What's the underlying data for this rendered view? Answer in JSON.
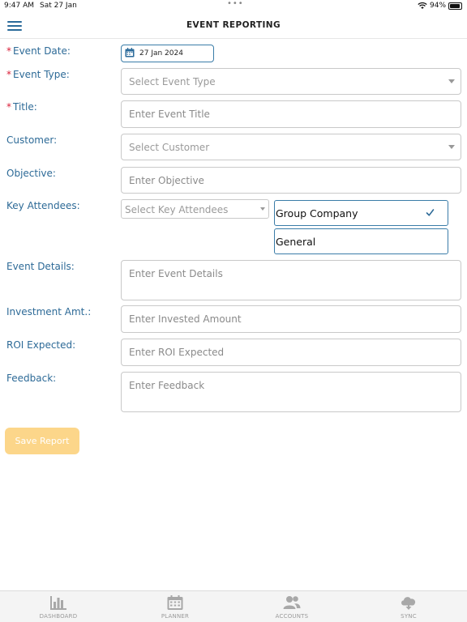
{
  "status_bar": {
    "time": "9:47 AM",
    "date": "Sat 27 Jan",
    "battery": "94%"
  },
  "header": {
    "title": "EVENT REPORTING"
  },
  "form": {
    "event_date": {
      "label": "Event Date:",
      "required": "*",
      "value": "27 Jan 2024"
    },
    "event_type": {
      "label": "Event Type:",
      "required": "*",
      "placeholder": "Select Event Type"
    },
    "title": {
      "label": "Title:",
      "required": "*",
      "placeholder": "Enter Event Title"
    },
    "customer": {
      "label": "Customer:",
      "placeholder": "Select Customer"
    },
    "objective": {
      "label": "Objective:",
      "placeholder": "Enter Objective"
    },
    "key_attendees": {
      "label": "Key Attendees:",
      "placeholder": "Select Key Attendees",
      "options": [
        {
          "label": "Group Company",
          "selected": true
        },
        {
          "label": "General",
          "selected": false
        }
      ]
    },
    "event_details": {
      "label": "Event Details:",
      "placeholder": "Enter Event Details"
    },
    "investment": {
      "label": "Investment Amt.:",
      "placeholder": "Enter Invested Amount"
    },
    "roi": {
      "label": "ROI Expected:",
      "placeholder": "Enter ROI Expected"
    },
    "feedback": {
      "label": "Feedback:",
      "placeholder": "Enter Feedback"
    }
  },
  "save_button": {
    "label": "Save Report"
  },
  "tab_bar": {
    "tabs": [
      {
        "label": "DASHBOARD",
        "icon": "bar-chart-icon"
      },
      {
        "label": "PLANNER",
        "icon": "calendar-icon"
      },
      {
        "label": "ACCOUNTS",
        "icon": "users-icon"
      },
      {
        "label": "SYNC",
        "icon": "cloud-download-icon"
      }
    ]
  },
  "colors": {
    "label": "#2d6a97",
    "required": "#d9213a",
    "accent": "#3a7ca8",
    "save_button": "#fcd68a"
  }
}
